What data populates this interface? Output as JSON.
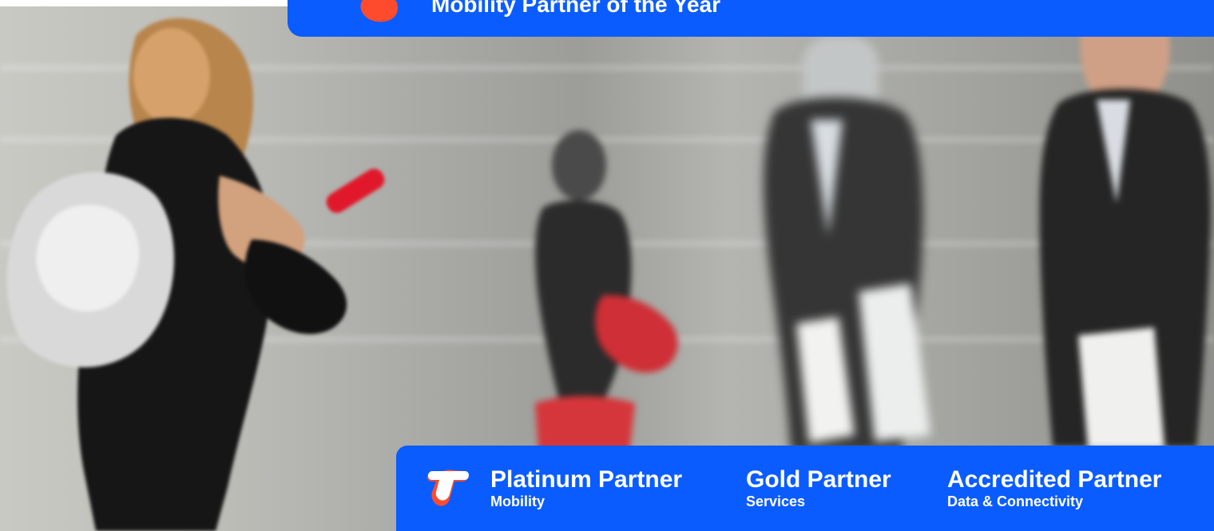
{
  "colors": {
    "brand_blue": "#0b5cff",
    "brand_orange": "#ff4b2d",
    "white": "#ffffff"
  },
  "top_banner": {
    "label": "Mobility Partner of the Year",
    "icon": "award-icon"
  },
  "bottom_banner": {
    "icon": "telstra-logo-icon",
    "partners": [
      {
        "title": "Platinum Partner",
        "subtitle": "Mobility"
      },
      {
        "title": "Gold Partner",
        "subtitle": "Services"
      },
      {
        "title": "Accredited Partner",
        "subtitle": "Data & Connectivity"
      }
    ]
  }
}
